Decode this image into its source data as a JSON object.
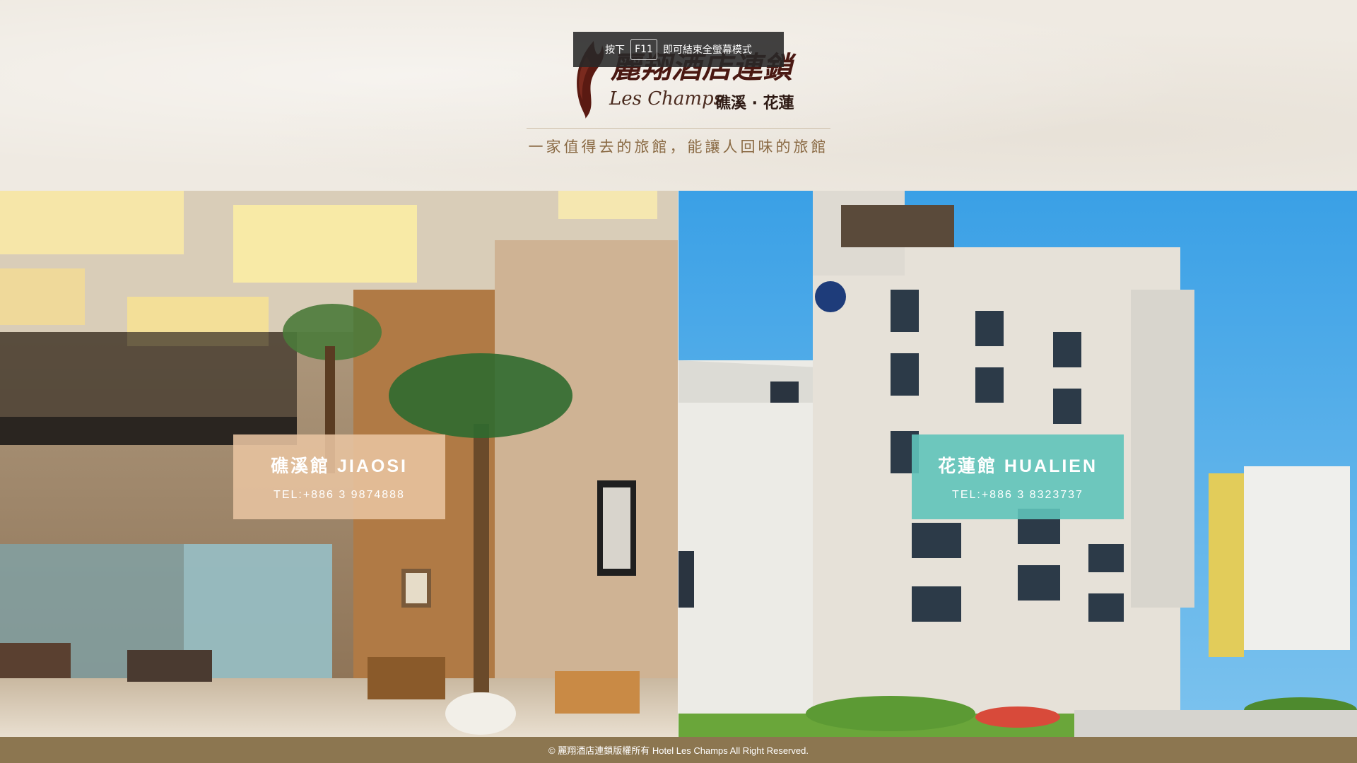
{
  "fullscreen_notice": {
    "prefix": "按下",
    "key": "F11",
    "suffix": "即可結束全螢幕模式"
  },
  "header": {
    "logo_cn": "麗翔酒店連鎖",
    "logo_en": "Les Champs",
    "logo_locations": "礁溪 · 花蓮",
    "tagline": "一家值得去的旅館，能讓人回味的旅館"
  },
  "hotels": [
    {
      "name": "礁溪館 JIAOSI",
      "tel": "TEL:+886 3 9874888",
      "accent": "#e8c4a0"
    },
    {
      "name": "花蓮館 HUALIEN",
      "tel": "TEL:+886 3 8323737",
      "accent": "#5fc4ba"
    }
  ],
  "footer": {
    "copyright": "© 麗翔酒店連鎖版權所有 Hotel Les Champs All Right Reserved."
  },
  "colors": {
    "header_bg": "#efeae2",
    "brand_dark": "#4a1812",
    "tagline": "#8a6a44",
    "footer_bg": "#8c7650"
  }
}
